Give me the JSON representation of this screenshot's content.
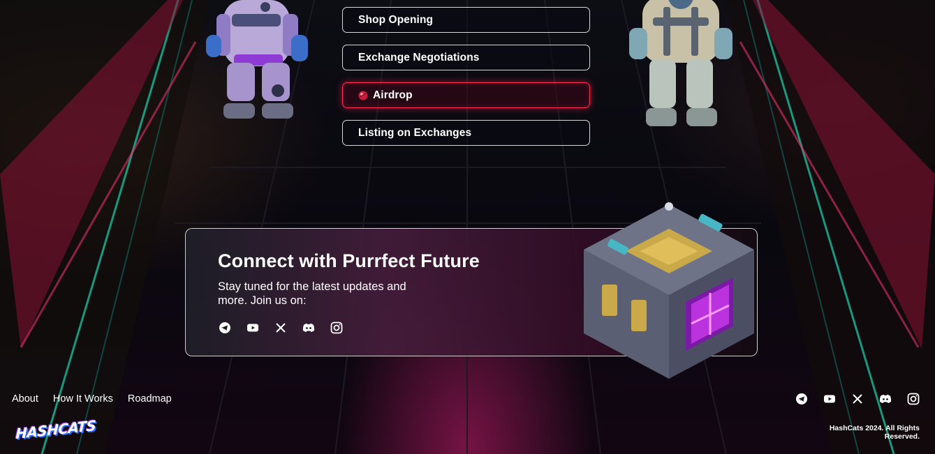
{
  "roadmap": {
    "steps": [
      {
        "label": "Shop Opening",
        "active": false
      },
      {
        "label": "Exchange Negotiations",
        "active": false
      },
      {
        "label": "Airdrop",
        "active": true,
        "icon": "red-ball-icon"
      },
      {
        "label": "Listing on Exchanges",
        "active": false
      }
    ]
  },
  "connect": {
    "title": "Connect with Purrfect Future",
    "subtitle": "Stay tuned for the latest updates and more. Join us on:",
    "social_icons": [
      "telegram-icon",
      "youtube-icon",
      "x-icon",
      "discord-icon",
      "instagram-icon"
    ]
  },
  "footer": {
    "nav": [
      "About",
      "How It Works",
      "Roadmap"
    ],
    "logo": "HASHCATS",
    "copyright": "HashCats 2024. All Rights Reserved.",
    "social_icons": [
      "telegram-icon",
      "youtube-icon",
      "x-icon",
      "discord-icon",
      "instagram-icon"
    ]
  },
  "colors": {
    "accent_active": "#ff2f5a",
    "neon_teal": "#19c9a6",
    "neon_magenta": "#d0207a",
    "text": "#ffffff"
  }
}
